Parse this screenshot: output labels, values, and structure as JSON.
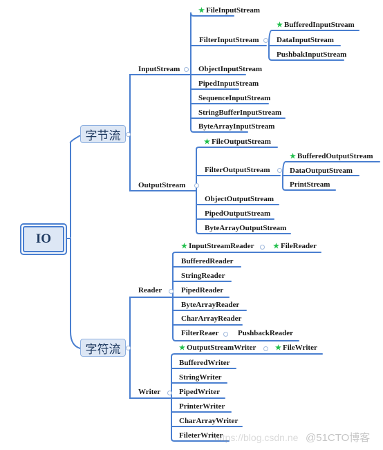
{
  "root": {
    "label": "IO"
  },
  "colors": {
    "line": "#4a7fd0",
    "node_fill": "#dde7f5",
    "star": "#1fbf4a"
  },
  "byte_stream": {
    "label": "字节流",
    "input": {
      "label": "InputStream",
      "children": [
        {
          "label": "FileInputStream",
          "starred": true
        },
        {
          "label": "FilterInputStream",
          "children": [
            {
              "label": "BufferedInputStream",
              "starred": true
            },
            {
              "label": "DataInputStream"
            },
            {
              "label": "PushbakInputStream"
            }
          ]
        },
        {
          "label": "ObjectInputStream"
        },
        {
          "label": "PipedInputStream"
        },
        {
          "label": "SequenceInputStream"
        },
        {
          "label": "StringBufferInputStream"
        },
        {
          "label": "ByteArrayInputStream"
        }
      ]
    },
    "output": {
      "label": "OutputStream",
      "children": [
        {
          "label": "FileOutputStream",
          "starred": true
        },
        {
          "label": "FilterOutputStream",
          "children": [
            {
              "label": "BufferedOutputStream",
              "starred": true
            },
            {
              "label": "DataOutputStream"
            },
            {
              "label": "PrintStream"
            }
          ]
        },
        {
          "label": "ObjectOutputStream"
        },
        {
          "label": "PipedOutputStream"
        },
        {
          "label": "ByteArrayOutputStream"
        }
      ]
    }
  },
  "char_stream": {
    "label": "字符流",
    "reader": {
      "label": "Reader",
      "children": [
        {
          "label": "InputStreamReader",
          "starred": true,
          "children": [
            {
              "label": "FileReader",
              "starred": true
            }
          ]
        },
        {
          "label": "BufferedReader"
        },
        {
          "label": "StringReader"
        },
        {
          "label": "PipedReader"
        },
        {
          "label": "ByteArrayReader"
        },
        {
          "label": "CharArrayReader"
        },
        {
          "label": "FilterReaer",
          "children": [
            {
              "label": "PushbackReader"
            }
          ]
        }
      ]
    },
    "writer": {
      "label": "Writer",
      "children": [
        {
          "label": "OutputStreamWriter",
          "starred": true,
          "children": [
            {
              "label": "FileWriter",
              "starred": true
            }
          ]
        },
        {
          "label": "BufferedWriter"
        },
        {
          "label": "StringWriter"
        },
        {
          "label": "PipedWriter"
        },
        {
          "label": "PrinterWriter"
        },
        {
          "label": "CharArrayWriter"
        },
        {
          "label": "FileterWriter"
        }
      ]
    }
  },
  "watermark": {
    "url": "https://blog.csdn.ne",
    "brand": "@51CTO博客"
  }
}
